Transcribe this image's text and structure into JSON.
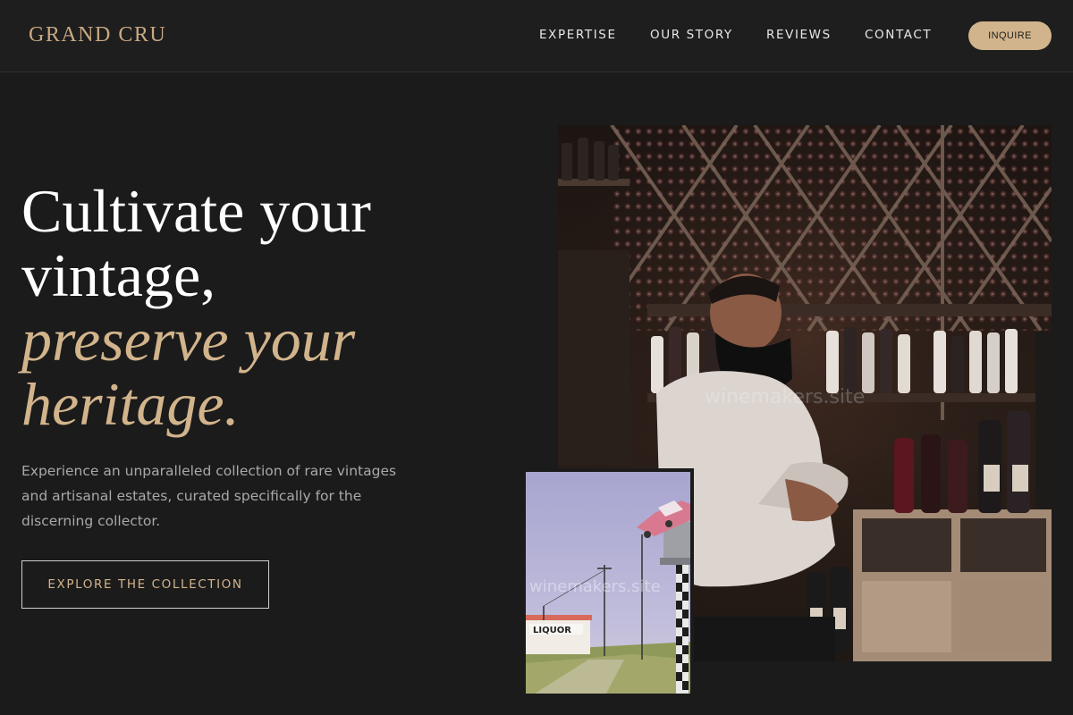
{
  "header": {
    "logo": "GRAND CRU",
    "nav": [
      "EXPERTISE",
      "OUR STORY",
      "REVIEWS",
      "CONTACT"
    ],
    "cta": "INQUIRE"
  },
  "hero": {
    "title_line1": "Cultivate your",
    "title_line2": "vintage,",
    "title_accent_line1": "preserve your",
    "title_accent_line2": "heritage.",
    "subtitle": "Experience an unparalleled collection of rare vintages and artisanal estates, curated specifically for the discerning collector.",
    "cta": "EXPLORE THE COLLECTION"
  },
  "images": {
    "main_watermark": "winemakers.site",
    "small_watermark": "winemakers.site",
    "small_sign": "LIQUOR"
  },
  "colors": {
    "background": "#1b1b1b",
    "accent": "#d2b48c",
    "text": "#ffffff",
    "muted": "#a9a9a9"
  }
}
